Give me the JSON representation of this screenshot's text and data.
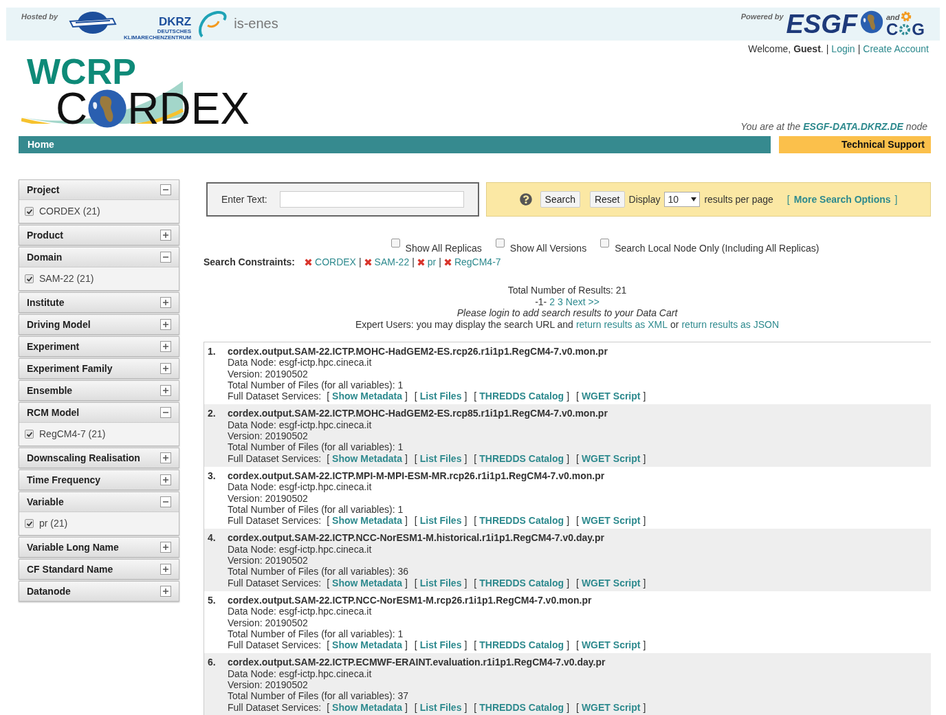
{
  "header": {
    "hosted_by": "Hosted by",
    "dkrz": "DKRZ",
    "dkrz_sub": "DEUTSCHES KLIMARECHENZENTRUM",
    "isenes": "is-enes",
    "powered_by": "Powered by",
    "esgf": "ESGF",
    "and": "and",
    "cog_left": "C",
    "cog_right": "G"
  },
  "user_bar": {
    "welcome": "Welcome,",
    "user": "Guest",
    "dot": ".",
    "sep1": "|",
    "login": "Login",
    "sep2": "|",
    "create": "Create Account"
  },
  "logo": {
    "wcrp": "WCRP",
    "cordex_left": "C",
    "cordex_right": "RDEX"
  },
  "node_line": {
    "prefix": "You are at the",
    "node": "ESGF-DATA.DKRZ.DE",
    "suffix": "node"
  },
  "nav": {
    "home": "Home",
    "support": "Technical Support"
  },
  "facets": [
    {
      "label": "Project",
      "expanded": true,
      "values": [
        {
          "label": "CORDEX (21)",
          "checked": true
        }
      ]
    },
    {
      "label": "Product",
      "expanded": false
    },
    {
      "label": "Domain",
      "expanded": true,
      "values": [
        {
          "label": "SAM-22 (21)",
          "checked": true
        }
      ]
    },
    {
      "label": "Institute",
      "expanded": false
    },
    {
      "label": "Driving Model",
      "expanded": false
    },
    {
      "label": "Experiment",
      "expanded": false
    },
    {
      "label": "Experiment Family",
      "expanded": false
    },
    {
      "label": "Ensemble",
      "expanded": false
    },
    {
      "label": "RCM Model",
      "expanded": true,
      "values": [
        {
          "label": "RegCM4-7 (21)",
          "checked": true
        }
      ]
    },
    {
      "label": "Downscaling Realisation",
      "expanded": false
    },
    {
      "label": "Time Frequency",
      "expanded": false
    },
    {
      "label": "Variable",
      "expanded": true,
      "values": [
        {
          "label": "pr (21)",
          "checked": true
        }
      ]
    },
    {
      "label": "Variable Long Name",
      "expanded": false
    },
    {
      "label": "CF Standard Name",
      "expanded": false
    },
    {
      "label": "Datanode",
      "expanded": false
    }
  ],
  "search": {
    "label": "Enter Text:",
    "search_button": "Search",
    "reset_button": "Reset",
    "display": "Display",
    "per_page": "10",
    "per_page_suffix": "results per page",
    "more_open": "[",
    "more": "More Search Options",
    "more_close": "]"
  },
  "options": [
    {
      "label": "Show All Replicas",
      "checked": false
    },
    {
      "label": "Show All Versions",
      "checked": false
    },
    {
      "label": "Search Local Node Only (Including All Replicas)",
      "checked": false
    }
  ],
  "constraints": {
    "label": "Search Constraints:",
    "items": [
      {
        "label": "CORDEX",
        "sep": "|"
      },
      {
        "label": "SAM-22",
        "sep": "|"
      },
      {
        "label": "pr",
        "sep": "|"
      },
      {
        "label": "RegCM4-7"
      }
    ]
  },
  "summary": {
    "total": "Total Number of Results: 21",
    "current_page": "-1-",
    "pages": [
      "2",
      "3",
      "Next >>"
    ],
    "login_note": "Please login to add search results to your Data Cart",
    "expert": "Expert Users: you may display the search URL and",
    "xml": "return results as XML",
    "or": "or",
    "json": "return results as JSON"
  },
  "results": [
    {
      "num": "1.",
      "title": "cordex.output.SAM-22.ICTP.MOHC-HadGEM2-ES.rcp26.r1i1p1.RegCM4-7.v0.mon.pr",
      "node": "Data Node: esgf-ictp.hpc.cineca.it",
      "version": "Version: 20190502",
      "files": "Total Number of Files (for all variables): 1",
      "services_label": "Full Dataset Services:",
      "services": [
        {
          "o": "[",
          "label": "Show Metadata",
          "c": "]"
        },
        {
          "o": "[",
          "label": "List Files",
          "c": "]"
        },
        {
          "o": "[",
          "label": "THREDDS Catalog",
          "c": "]"
        },
        {
          "o": "[",
          "label": "WGET Script",
          "c": "]"
        }
      ]
    },
    {
      "num": "2.",
      "title": "cordex.output.SAM-22.ICTP.MOHC-HadGEM2-ES.rcp85.r1i1p1.RegCM4-7.v0.mon.pr",
      "node": "Data Node: esgf-ictp.hpc.cineca.it",
      "version": "Version: 20190502",
      "files": "Total Number of Files (for all variables): 1",
      "services_label": "Full Dataset Services:",
      "services": [
        {
          "o": "[",
          "label": "Show Metadata",
          "c": "]"
        },
        {
          "o": "[",
          "label": "List Files",
          "c": "]"
        },
        {
          "o": "[",
          "label": "THREDDS Catalog",
          "c": "]"
        },
        {
          "o": "[",
          "label": "WGET Script",
          "c": "]"
        }
      ]
    },
    {
      "num": "3.",
      "title": "cordex.output.SAM-22.ICTP.MPI-M-MPI-ESM-MR.rcp26.r1i1p1.RegCM4-7.v0.mon.pr",
      "node": "Data Node: esgf-ictp.hpc.cineca.it",
      "version": "Version: 20190502",
      "files": "Total Number of Files (for all variables): 1",
      "services_label": "Full Dataset Services:",
      "services": [
        {
          "o": "[",
          "label": "Show Metadata",
          "c": "]"
        },
        {
          "o": "[",
          "label": "List Files",
          "c": "]"
        },
        {
          "o": "[",
          "label": "THREDDS Catalog",
          "c": "]"
        },
        {
          "o": "[",
          "label": "WGET Script",
          "c": "]"
        }
      ]
    },
    {
      "num": "4.",
      "title": "cordex.output.SAM-22.ICTP.NCC-NorESM1-M.historical.r1i1p1.RegCM4-7.v0.day.pr",
      "node": "Data Node: esgf-ictp.hpc.cineca.it",
      "version": "Version: 20190502",
      "files": "Total Number of Files (for all variables): 36",
      "services_label": "Full Dataset Services:",
      "services": [
        {
          "o": "[",
          "label": "Show Metadata",
          "c": "]"
        },
        {
          "o": "[",
          "label": "List Files",
          "c": "]"
        },
        {
          "o": "[",
          "label": "THREDDS Catalog",
          "c": "]"
        },
        {
          "o": "[",
          "label": "WGET Script",
          "c": "]"
        }
      ]
    },
    {
      "num": "5.",
      "title": "cordex.output.SAM-22.ICTP.NCC-NorESM1-M.rcp26.r1i1p1.RegCM4-7.v0.mon.pr",
      "node": "Data Node: esgf-ictp.hpc.cineca.it",
      "version": "Version: 20190502",
      "files": "Total Number of Files (for all variables): 1",
      "services_label": "Full Dataset Services:",
      "services": [
        {
          "o": "[",
          "label": "Show Metadata",
          "c": "]"
        },
        {
          "o": "[",
          "label": "List Files",
          "c": "]"
        },
        {
          "o": "[",
          "label": "THREDDS Catalog",
          "c": "]"
        },
        {
          "o": "[",
          "label": "WGET Script",
          "c": "]"
        }
      ]
    },
    {
      "num": "6.",
      "title": "cordex.output.SAM-22.ICTP.ECMWF-ERAINT.evaluation.r1i1p1.RegCM4-7.v0.day.pr",
      "node": "Data Node: esgf-ictp.hpc.cineca.it",
      "version": "Version: 20190502",
      "files": "Total Number of Files (for all variables): 37",
      "services_label": "Full Dataset Services:",
      "services": [
        {
          "o": "[",
          "label": "Show Metadata",
          "c": "]"
        },
        {
          "o": "[",
          "label": "List Files",
          "c": "]"
        },
        {
          "o": "[",
          "label": "THREDDS Catalog",
          "c": "]"
        },
        {
          "o": "[",
          "label": "WGET Script",
          "c": "]"
        }
      ]
    }
  ]
}
